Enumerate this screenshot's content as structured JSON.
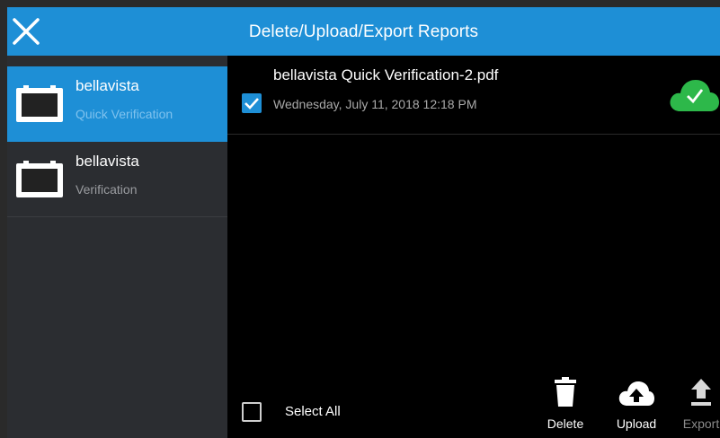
{
  "header": {
    "title": "Delete/Upload/Export Reports"
  },
  "sidebar": {
    "items": [
      {
        "name": "bellavista",
        "subtitle": "Quick Verification",
        "active": true
      },
      {
        "name": "bellavista",
        "subtitle": "Verification",
        "active": false
      }
    ]
  },
  "files": [
    {
      "name": "bellavista Quick Verification-2.pdf",
      "date": "Wednesday, July 11, 2018 12:18 PM",
      "checked": true,
      "status_icon": "cloud-check-icon",
      "status_color": "#2db84a"
    }
  ],
  "footer": {
    "select_all_label": "Select All",
    "delete_label": "Delete",
    "upload_label": "Upload",
    "export_label": "Export"
  },
  "colors": {
    "accent": "#1e8fd6",
    "sidebar_bg": "#2b2d31",
    "success": "#2db84a",
    "disabled": "#8a8a8a"
  }
}
